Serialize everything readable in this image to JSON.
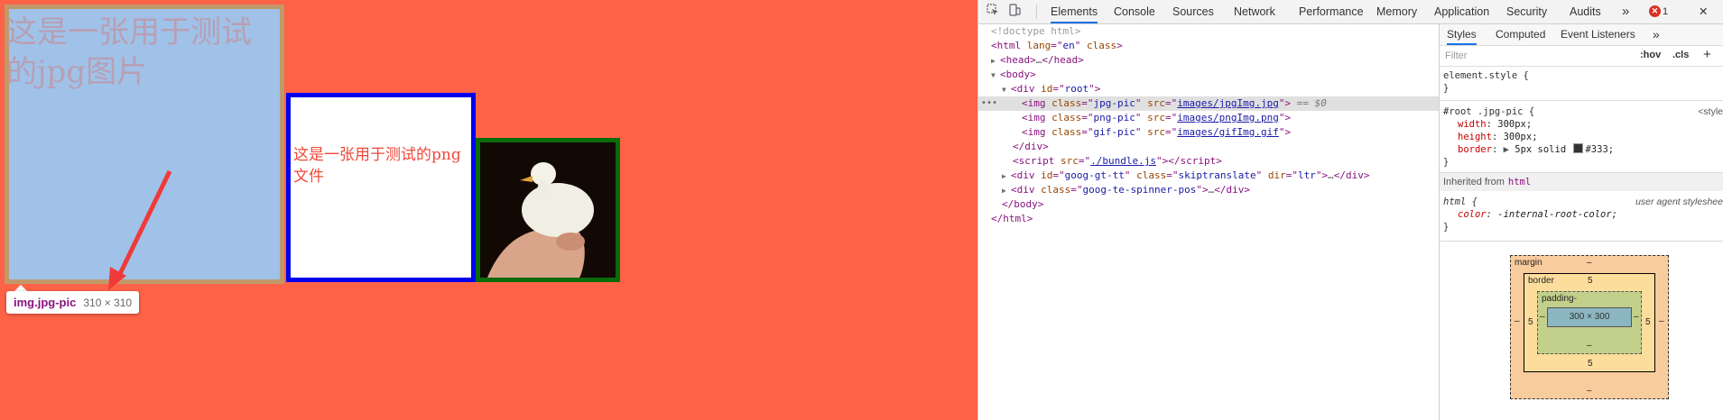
{
  "page": {
    "background": "#ff6347",
    "jpg_text": "这是一张用于测试的jpg图片",
    "png_text": "这是一张用于测试的png文件",
    "tooltip": {
      "name": "img.jpg-pic",
      "size": "310 × 310"
    }
  },
  "devtools": {
    "toolbar_icons": [
      "inspect-icon",
      "device-toolbar-icon"
    ],
    "tabs": [
      "Elements",
      "Console",
      "Sources",
      "Network",
      "Performance",
      "Memory",
      "Application",
      "Security",
      "Audits"
    ],
    "active_tab": "Elements",
    "overflow": "»",
    "error_count": "1",
    "close": "✕",
    "dom_lines": {
      "doctype": "<!doctype html>",
      "html_open": {
        "tag": "html",
        "attr1": "lang",
        "val1": "en",
        "attr2": "class"
      },
      "head": {
        "open": "<head>",
        "ellipsis": "…",
        "close": "</head>"
      },
      "body_open": "<body>",
      "root_div": {
        "tag": "div",
        "attr": "id",
        "val": "root"
      },
      "img1": {
        "class": "jpg-pic",
        "src": "images/jpgImg.jpg",
        "ref": "== $0"
      },
      "img2": {
        "class": "png-pic",
        "src": "images/pngImg.png"
      },
      "img3": {
        "class": "gif-pic",
        "src": "images/gifImg.gif"
      },
      "div_close": "</div>",
      "script": {
        "src": "./bundle.js"
      },
      "goog_div": {
        "id": "goog-gt-tt",
        "class": "skiptranslate",
        "dir": "ltr"
      },
      "spinner_div": {
        "class": "goog-te-spinner-pos"
      },
      "body_close": "</body>",
      "html_close": "</html>"
    },
    "styles": {
      "tabs": [
        "Styles",
        "Computed",
        "Event Listeners"
      ],
      "overflow": "»",
      "filter_placeholder": "Filter",
      "hov": ":hov",
      "cls": ".cls",
      "plus": "+",
      "element_style": "element.style {",
      "close_brace": "}",
      "rule_selector": "#root .jpg-pic {",
      "rule_source": "<style",
      "props": [
        {
          "name": "width",
          "value": "300px;"
        },
        {
          "name": "height",
          "value": "300px;"
        },
        {
          "name": "border",
          "value": "5px solid",
          "extra": "#333;"
        }
      ],
      "inherited_label": "Inherited from",
      "inherited_tag": "html",
      "ua_selector": "html {",
      "ua_source": "user agent styleshee",
      "ua_prop": {
        "name": "color",
        "value": "-internal-root-color;"
      }
    },
    "box_model": {
      "margin_label": "margin",
      "margin_top": "–",
      "margin_left": "–",
      "margin_right": "–",
      "margin_bottom": "–",
      "border_label": "border",
      "border_top": "5",
      "border_left": "5",
      "border_right": "5",
      "border_bottom": "5",
      "padding_label": "padding-",
      "padding_left": "–",
      "padding_right": "–",
      "padding_bottom": "–",
      "content": "300 × 300"
    }
  }
}
